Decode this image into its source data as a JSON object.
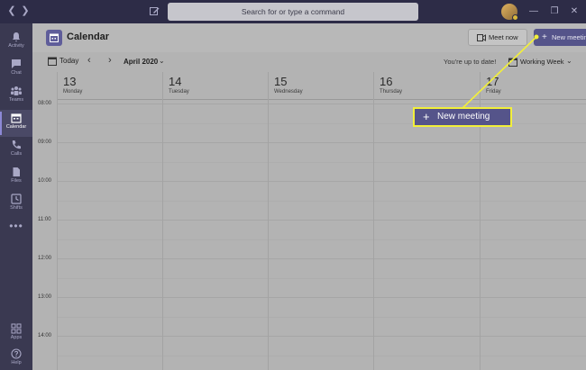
{
  "titlebar": {
    "search_placeholder": "Search for or type a command",
    "back_icon": "chevron-left-icon",
    "forward_icon": "chevron-right-icon"
  },
  "rail": {
    "items": [
      {
        "label": "Activity",
        "icon": "bell-icon"
      },
      {
        "label": "Chat",
        "icon": "chat-icon"
      },
      {
        "label": "Teams",
        "icon": "teams-icon"
      },
      {
        "label": "Calendar",
        "icon": "calendar-icon",
        "active": true
      },
      {
        "label": "Calls",
        "icon": "phone-icon"
      },
      {
        "label": "Files",
        "icon": "file-icon"
      },
      {
        "label": "Shifts",
        "icon": "clock-icon"
      }
    ],
    "more_label": "•••",
    "apps_label": "Apps",
    "help_label": "Help"
  },
  "header": {
    "title": "Calendar",
    "meet_now_label": "Meet now",
    "new_meeting_label": "New meeting"
  },
  "toolbar": {
    "today_label": "Today",
    "month_label": "April 2020",
    "status_text": "You're up to date!",
    "view_label": "Working Week"
  },
  "days": [
    {
      "num": "13",
      "name": "Monday"
    },
    {
      "num": "14",
      "name": "Tuesday"
    },
    {
      "num": "15",
      "name": "Wednesday"
    },
    {
      "num": "16",
      "name": "Thursday"
    },
    {
      "num": "17",
      "name": "Friday"
    }
  ],
  "times": [
    "08:00",
    "09:00",
    "10:00",
    "11:00",
    "12:00",
    "13:00",
    "14:00"
  ],
  "callout": {
    "label": "New meeting",
    "highlight_color": "#f2ef3a"
  },
  "colors": {
    "accent": "#55548a",
    "rail_bg": "#3a3951",
    "titlebar_bg": "#2d2c47"
  }
}
